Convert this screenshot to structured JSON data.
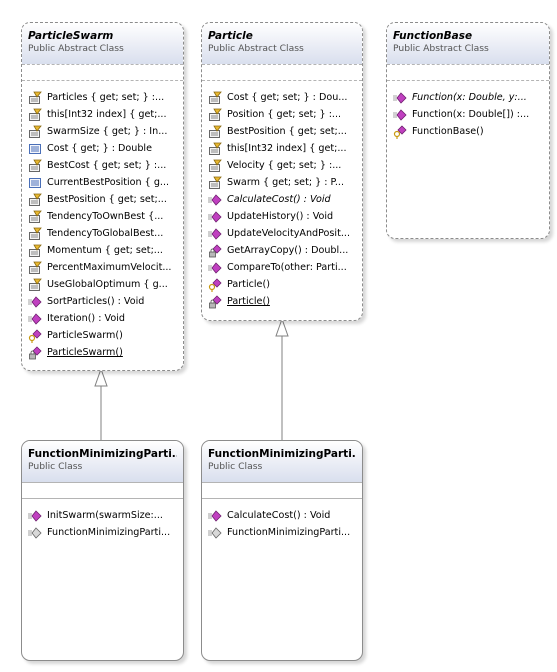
{
  "classes": [
    {
      "id": "particle_swarm",
      "name": "ParticleSwarm",
      "stereotype": "Public Abstract Class",
      "members": [
        {
          "icon": "property-icon",
          "text": "Particles { get; set; } :..."
        },
        {
          "icon": "property-icon",
          "text": "this[Int32 index] { get;..."
        },
        {
          "icon": "property-icon",
          "text": "SwarmSize { get; } : In..."
        },
        {
          "icon": "field-icon",
          "text": "Cost { get; } : Double"
        },
        {
          "icon": "property-icon",
          "text": "BestCost { get; set; } :..."
        },
        {
          "icon": "field-icon",
          "text": "CurrentBestPosition { g..."
        },
        {
          "icon": "property-icon",
          "text": "BestPosition { get; set;..."
        },
        {
          "icon": "property-icon",
          "text": "TendencyToOwnBest {..."
        },
        {
          "icon": "property-icon",
          "text": "TendencyToGlobalBest..."
        },
        {
          "icon": "property-icon",
          "text": "Momentum { get; set;..."
        },
        {
          "icon": "property-icon",
          "text": "PercentMaximumVelocit..."
        },
        {
          "icon": "property-icon",
          "text": "UseGlobalOptimum { g..."
        },
        {
          "icon": "method-icon",
          "text": "SortParticles() : Void"
        },
        {
          "icon": "method-icon",
          "text": "Iteration() : Void"
        },
        {
          "icon": "protected-method-icon",
          "text": "ParticleSwarm()"
        },
        {
          "icon": "private-static-method-icon",
          "text": "ParticleSwarm()",
          "underline": true
        }
      ]
    },
    {
      "id": "particle",
      "name": "Particle",
      "stereotype": "Public Abstract Class",
      "members": [
        {
          "icon": "property-icon",
          "text": "Cost { get; set; } : Dou..."
        },
        {
          "icon": "property-icon",
          "text": "Position { get; set; } :..."
        },
        {
          "icon": "property-icon",
          "text": "BestPosition { get; set;..."
        },
        {
          "icon": "property-icon",
          "text": "this[Int32 index] { get;..."
        },
        {
          "icon": "property-icon",
          "text": "Velocity { get; set; } :..."
        },
        {
          "icon": "property-icon",
          "text": "Swarm { get; set; } : P..."
        },
        {
          "icon": "method-icon",
          "text": "CalculateCost() : Void",
          "italic": true
        },
        {
          "icon": "method-icon",
          "text": "UpdateHistory() : Void"
        },
        {
          "icon": "method-icon",
          "text": "UpdateVelocityAndPosit..."
        },
        {
          "icon": "private-static-method-icon",
          "text": "GetArrayCopy() : Doubl..."
        },
        {
          "icon": "method-icon",
          "text": "CompareTo(other: Parti..."
        },
        {
          "icon": "protected-method-icon",
          "text": "Particle()"
        },
        {
          "icon": "private-static-method-icon",
          "text": "Particle()",
          "underline": true
        }
      ]
    },
    {
      "id": "function_base",
      "name": "FunctionBase",
      "stereotype": "Public Abstract Class",
      "members": [
        {
          "icon": "method-icon",
          "text": "Function(x: Double, y:...",
          "italic": true
        },
        {
          "icon": "method-icon",
          "text": "Function(x: Double[]) :..."
        },
        {
          "icon": "protected-method-icon",
          "text": "FunctionBase()"
        }
      ]
    },
    {
      "id": "fmps",
      "name": "FunctionMinimizingParti...",
      "stereotype": "Public Class",
      "members": [
        {
          "icon": "method-icon",
          "text": "InitSwarm(swarmSize:..."
        },
        {
          "icon": "constructor-icon",
          "text": "FunctionMinimizingParti..."
        }
      ]
    },
    {
      "id": "fmp",
      "name": "FunctionMinimizingParti...",
      "stereotype": "Public Class",
      "members": [
        {
          "icon": "method-icon",
          "text": "CalculateCost() : Void"
        },
        {
          "icon": "constructor-icon",
          "text": "FunctionMinimizingParti..."
        }
      ]
    }
  ],
  "colors": {
    "border": "#8c8c8c",
    "header_bottom": "#d9dfee",
    "method": "#c040c0",
    "property": "#e8b830",
    "field": "#4a6fb8",
    "connector": "#808080"
  }
}
